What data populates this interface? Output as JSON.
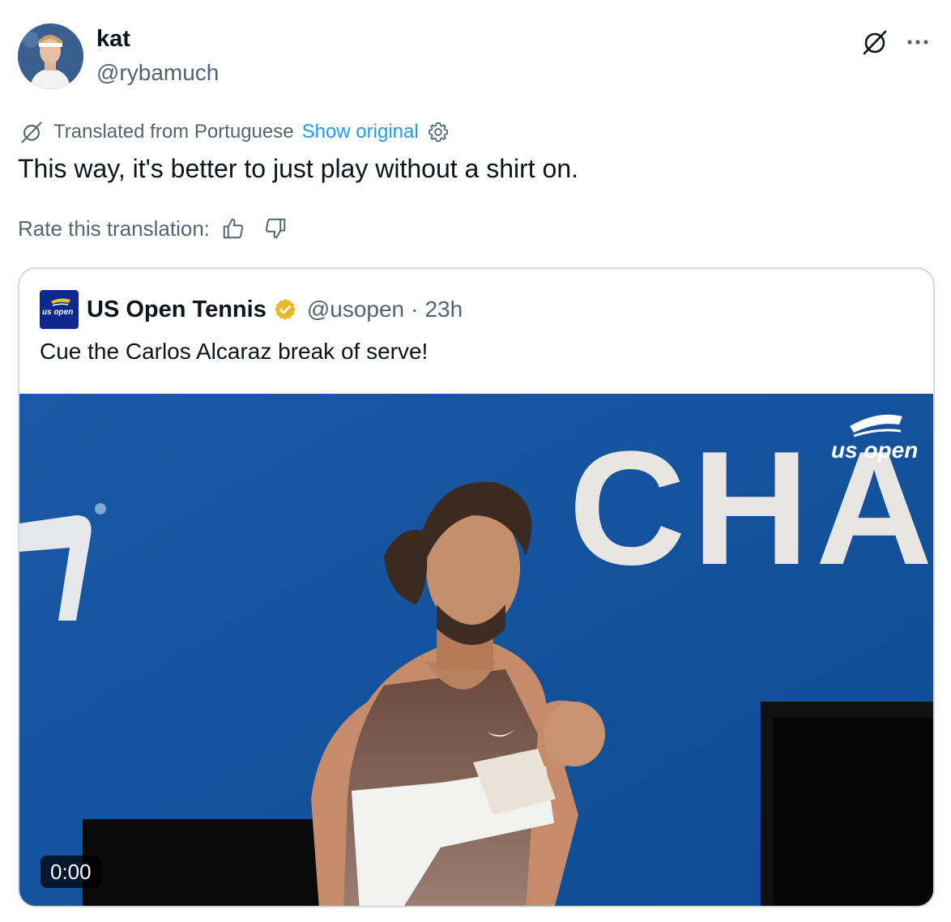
{
  "author": {
    "name": "kat",
    "handle": "@rybamuch"
  },
  "icons": {
    "grok": "grok-slash-circle-icon",
    "more": "more-horizontal-icon",
    "translate": "grok-slash-circle-icon",
    "settings": "gear-icon",
    "thumb_up": "thumbs-up-icon",
    "thumb_down": "thumbs-down-icon",
    "verified": "gold-verified-badge-icon"
  },
  "translation": {
    "label": "Translated from Portuguese",
    "show_original": "Show original"
  },
  "tweet": {
    "text": "This way, it's better to just play without a shirt on."
  },
  "rating": {
    "label": "Rate this translation:"
  },
  "quoted": {
    "name": "US Open Tennis",
    "handle": "@usopen",
    "separator": "·",
    "time": "23h",
    "text": "Cue the Carlos Alcaraz break of serve!",
    "logo_text": "us open",
    "media": {
      "watermark": "us open",
      "banner_text": "CHA",
      "timestamp": "0:00"
    }
  },
  "colors": {
    "text_primary": "#0f1419",
    "text_secondary": "#536471",
    "link": "#1d9bf0",
    "border": "#cfd9de",
    "verified_gold": "#e8b829",
    "court_blue": "#14549e"
  }
}
